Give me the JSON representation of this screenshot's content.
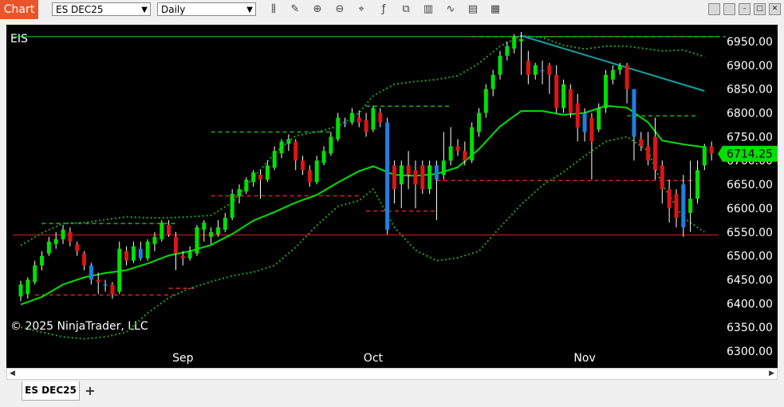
{
  "toolbar": {
    "badge": "Chart",
    "instrument": "ES DEC25",
    "interval": "Daily",
    "tools": [
      {
        "name": "bar-type-icon",
        "glyph": "⫼"
      },
      {
        "name": "draw-pencil-icon",
        "glyph": "✎"
      },
      {
        "name": "zoom-in-icon",
        "glyph": "⊕"
      },
      {
        "name": "zoom-out-icon",
        "glyph": "⊖"
      },
      {
        "name": "crosshair-icon",
        "glyph": "⌖"
      },
      {
        "name": "indicators-icon",
        "glyph": "ƒ"
      },
      {
        "name": "strategies-icon",
        "glyph": "⧉"
      },
      {
        "name": "data-box-icon",
        "glyph": "▥"
      },
      {
        "name": "performance-icon",
        "glyph": "∿"
      },
      {
        "name": "properties-icon",
        "glyph": "▤"
      },
      {
        "name": "hide-icon",
        "glyph": "▦"
      }
    ]
  },
  "chart": {
    "symbol_label": "EIS",
    "copyright": "© 2025 NinjaTrader, LLC",
    "current_price": "6714.25",
    "colors": {
      "up": "#00e000",
      "down": "#e01414",
      "neutral": "#1f7fe0",
      "sma": "#00e000",
      "band": "#1fa01f",
      "trend": "#10a0a0"
    }
  },
  "chart_data": {
    "type": "candlestick",
    "y_ticks": [
      "6950.00",
      "6900.00",
      "6850.00",
      "6800.00",
      "6750.00",
      "6700.00",
      "6650.00",
      "6600.00",
      "6550.00",
      "6500.00",
      "6450.00",
      "6400.00",
      "6350.00",
      "6300.00"
    ],
    "ylim": [
      6265,
      6985
    ],
    "x_labels": [
      {
        "text": "Sep",
        "index": 23
      },
      {
        "text": "Oct",
        "index": 50
      },
      {
        "text": "Nov",
        "index": 80
      }
    ],
    "candles": [
      [
        6415,
        6440,
        6405,
        6448
      ],
      [
        6420,
        6450,
        6410,
        6455
      ],
      [
        6445,
        6480,
        6440,
        6490
      ],
      [
        6480,
        6500,
        6470,
        6510
      ],
      [
        6505,
        6530,
        6500,
        6540
      ],
      [
        6525,
        6535,
        6515,
        6550
      ],
      [
        6535,
        6555,
        6525,
        6565
      ],
      [
        6550,
        6530,
        6520,
        6560
      ],
      [
        6525,
        6510,
        6500,
        6530
      ],
      [
        6505,
        6480,
        6470,
        6510
      ],
      [
        6480,
        6450,
        6440,
        6485
      ],
      [
        6450,
        6445,
        6420,
        6465
      ],
      [
        6440,
        6440,
        6425,
        6450
      ],
      [
        6440,
        6420,
        6410,
        6445
      ],
      [
        6425,
        6515,
        6420,
        6530
      ],
      [
        6510,
        6490,
        6480,
        6520
      ],
      [
        6490,
        6520,
        6485,
        6530
      ],
      [
        6515,
        6495,
        6490,
        6530
      ],
      [
        6495,
        6530,
        6490,
        6535
      ],
      [
        6525,
        6540,
        6510,
        6550
      ],
      [
        6535,
        6570,
        6530,
        6575
      ],
      [
        6565,
        6545,
        6540,
        6575
      ],
      [
        6540,
        6505,
        6470,
        6550
      ],
      [
        6500,
        6495,
        6480,
        6510
      ],
      [
        6495,
        6510,
        6490,
        6520
      ],
      [
        6505,
        6560,
        6500,
        6565
      ],
      [
        6555,
        6570,
        6530,
        6575
      ],
      [
        6540,
        6550,
        6525,
        6560
      ],
      [
        6545,
        6560,
        6540,
        6575
      ],
      [
        6555,
        6580,
        6550,
        6590
      ],
      [
        6580,
        6630,
        6575,
        6640
      ],
      [
        6625,
        6640,
        6610,
        6650
      ],
      [
        6635,
        6660,
        6630,
        6665
      ],
      [
        6655,
        6675,
        6645,
        6680
      ],
      [
        6670,
        6660,
        6620,
        6680
      ],
      [
        6660,
        6690,
        6655,
        6700
      ],
      [
        6685,
        6720,
        6680,
        6730
      ],
      [
        6715,
        6740,
        6705,
        6745
      ],
      [
        6735,
        6745,
        6720,
        6755
      ],
      [
        6740,
        6700,
        6680,
        6745
      ],
      [
        6700,
        6680,
        6670,
        6710
      ],
      [
        6680,
        6655,
        6645,
        6690
      ],
      [
        6655,
        6700,
        6650,
        6710
      ],
      [
        6695,
        6720,
        6690,
        6730
      ],
      [
        6715,
        6750,
        6710,
        6760
      ],
      [
        6745,
        6790,
        6740,
        6800
      ],
      [
        6780,
        6780,
        6770,
        6790
      ],
      [
        6780,
        6800,
        6775,
        6810
      ],
      [
        6790,
        6780,
        6770,
        6805
      ],
      [
        6785,
        6760,
        6750,
        6800
      ],
      [
        6765,
        6810,
        6760,
        6815
      ],
      [
        6800,
        6780,
        6770,
        6810
      ],
      [
        6780,
        6555,
        6545,
        6790
      ],
      [
        6690,
        6640,
        6610,
        6700
      ],
      [
        6650,
        6690,
        6600,
        6700
      ],
      [
        6690,
        6670,
        6640,
        6720
      ],
      [
        6680,
        6650,
        6600,
        6700
      ],
      [
        6690,
        6640,
        6630,
        6700
      ],
      [
        6640,
        6690,
        6630,
        6700
      ],
      [
        6690,
        6660,
        6575,
        6700
      ],
      [
        6670,
        6700,
        6660,
        6760
      ],
      [
        6700,
        6730,
        6690,
        6770
      ],
      [
        6730,
        6720,
        6710,
        6745
      ],
      [
        6720,
        6700,
        6690,
        6740
      ],
      [
        6700,
        6770,
        6695,
        6780
      ],
      [
        6760,
        6800,
        6750,
        6810
      ],
      [
        6800,
        6850,
        6790,
        6860
      ],
      [
        6850,
        6880,
        6835,
        6890
      ],
      [
        6880,
        6920,
        6870,
        6930
      ],
      [
        6920,
        6940,
        6910,
        6950
      ],
      [
        6935,
        6960,
        6925,
        6965
      ],
      [
        6950,
        6955,
        6880,
        6970
      ],
      [
        6910,
        6880,
        6860,
        6930
      ],
      [
        6880,
        6900,
        6870,
        6905
      ],
      [
        6890,
        6890,
        6860,
        6910
      ],
      [
        6900,
        6880,
        6840,
        6905
      ],
      [
        6880,
        6810,
        6800,
        6900
      ],
      [
        6810,
        6860,
        6800,
        6870
      ],
      [
        6850,
        6800,
        6790,
        6860
      ],
      [
        6820,
        6770,
        6740,
        6840
      ],
      [
        6800,
        6760,
        6740,
        6810
      ],
      [
        6790,
        6740,
        6660,
        6800
      ],
      [
        6765,
        6810,
        6760,
        6820
      ],
      [
        6810,
        6880,
        6800,
        6890
      ],
      [
        6870,
        6890,
        6860,
        6900
      ],
      [
        6890,
        6900,
        6880,
        6905
      ],
      [
        6900,
        6850,
        6820,
        6905
      ],
      [
        6850,
        6750,
        6700,
        6850
      ],
      [
        6745,
        6730,
        6720,
        6760
      ],
      [
        6730,
        6700,
        6690,
        6760
      ],
      [
        6750,
        6680,
        6660,
        6790
      ],
      [
        6690,
        6640,
        6610,
        6700
      ],
      [
        6640,
        6600,
        6570,
        6660
      ],
      [
        6630,
        6580,
        6560,
        6640
      ],
      [
        6650,
        6560,
        6540,
        6670
      ],
      [
        6590,
        6620,
        6550,
        6700
      ],
      [
        6620,
        6680,
        6610,
        6700
      ],
      [
        6690,
        6730,
        6680,
        6735
      ],
      [
        6730,
        6715,
        6700,
        6740
      ]
    ],
    "sma": [
      [
        0,
        6398
      ],
      [
        3,
        6414
      ],
      [
        6,
        6440
      ],
      [
        9,
        6455
      ],
      [
        12,
        6464
      ],
      [
        15,
        6470
      ],
      [
        18,
        6484
      ],
      [
        21,
        6501
      ],
      [
        24,
        6510
      ],
      [
        27,
        6523
      ],
      [
        30,
        6546
      ],
      [
        33,
        6574
      ],
      [
        36,
        6592
      ],
      [
        39,
        6612
      ],
      [
        42,
        6628
      ],
      [
        45,
        6654
      ],
      [
        48,
        6678
      ],
      [
        50,
        6688
      ],
      [
        53,
        6670
      ],
      [
        56,
        6668
      ],
      [
        59,
        6672
      ],
      [
        62,
        6686
      ],
      [
        65,
        6724
      ],
      [
        68,
        6772
      ],
      [
        71,
        6804
      ],
      [
        74,
        6804
      ],
      [
        77,
        6796
      ],
      [
        80,
        6800
      ],
      [
        83,
        6815
      ],
      [
        86,
        6811
      ],
      [
        89,
        6780
      ],
      [
        91,
        6742
      ],
      [
        94,
        6734
      ],
      [
        97,
        6728
      ]
    ],
    "upper_band": [
      [
        0,
        6522
      ],
      [
        3,
        6548
      ],
      [
        6,
        6568
      ],
      [
        9,
        6570
      ],
      [
        12,
        6576
      ],
      [
        15,
        6582
      ],
      [
        18,
        6580
      ],
      [
        21,
        6580
      ],
      [
        24,
        6582
      ],
      [
        27,
        6585
      ],
      [
        30,
        6612
      ],
      [
        33,
        6664
      ],
      [
        36,
        6715
      ],
      [
        39,
        6752
      ],
      [
        42,
        6760
      ],
      [
        45,
        6772
      ],
      [
        48,
        6800
      ],
      [
        50,
        6836
      ],
      [
        53,
        6860
      ],
      [
        56,
        6866
      ],
      [
        59,
        6870
      ],
      [
        62,
        6878
      ],
      [
        65,
        6904
      ],
      [
        68,
        6940
      ],
      [
        71,
        6962
      ],
      [
        74,
        6958
      ],
      [
        77,
        6942
      ],
      [
        80,
        6934
      ],
      [
        83,
        6940
      ],
      [
        86,
        6940
      ],
      [
        89,
        6934
      ],
      [
        91,
        6930
      ],
      [
        94,
        6932
      ],
      [
        97,
        6918
      ]
    ],
    "lower_band": [
      [
        0,
        6350
      ],
      [
        3,
        6340
      ],
      [
        6,
        6330
      ],
      [
        9,
        6326
      ],
      [
        12,
        6330
      ],
      [
        15,
        6340
      ],
      [
        18,
        6380
      ],
      [
        21,
        6412
      ],
      [
        24,
        6432
      ],
      [
        27,
        6446
      ],
      [
        30,
        6458
      ],
      [
        33,
        6466
      ],
      [
        36,
        6480
      ],
      [
        39,
        6518
      ],
      [
        42,
        6564
      ],
      [
        45,
        6604
      ],
      [
        48,
        6616
      ],
      [
        50,
        6640
      ],
      [
        53,
        6560
      ],
      [
        56,
        6512
      ],
      [
        59,
        6490
      ],
      [
        62,
        6496
      ],
      [
        65,
        6510
      ],
      [
        68,
        6560
      ],
      [
        71,
        6608
      ],
      [
        74,
        6648
      ],
      [
        77,
        6676
      ],
      [
        80,
        6710
      ],
      [
        83,
        6740
      ],
      [
        86,
        6750
      ],
      [
        89,
        6720
      ],
      [
        91,
        6650
      ],
      [
        94,
        6580
      ],
      [
        97,
        6550
      ]
    ],
    "levels": {
      "solid": [
        6960,
        6544
      ],
      "red_dashed": [
        {
          "x0": 2,
          "x1": 22,
          "y": 6418
        },
        {
          "x0": 21,
          "x1": 25,
          "y": 6432
        },
        {
          "x0": 27,
          "x1": 48,
          "y": 6626
        },
        {
          "x0": 49,
          "x1": 59,
          "y": 6594
        },
        {
          "x0": 59,
          "x1": 96,
          "y": 6658
        }
      ],
      "green_dashed": [
        {
          "x0": 3,
          "x1": 22,
          "y": 6568
        },
        {
          "x0": 27,
          "x1": 44,
          "y": 6760
        },
        {
          "x0": 49,
          "x1": 61,
          "y": 6814
        },
        {
          "x0": 64,
          "x1": 100,
          "y": 6960
        },
        {
          "x0": 86,
          "x1": 96,
          "y": 6794
        }
      ]
    },
    "trendline": [
      [
        71,
        6962
      ],
      [
        97,
        6846
      ]
    ],
    "fib": [
      [
        10,
        6410
      ],
      [
        24,
        6410
      ]
    ]
  }
}
